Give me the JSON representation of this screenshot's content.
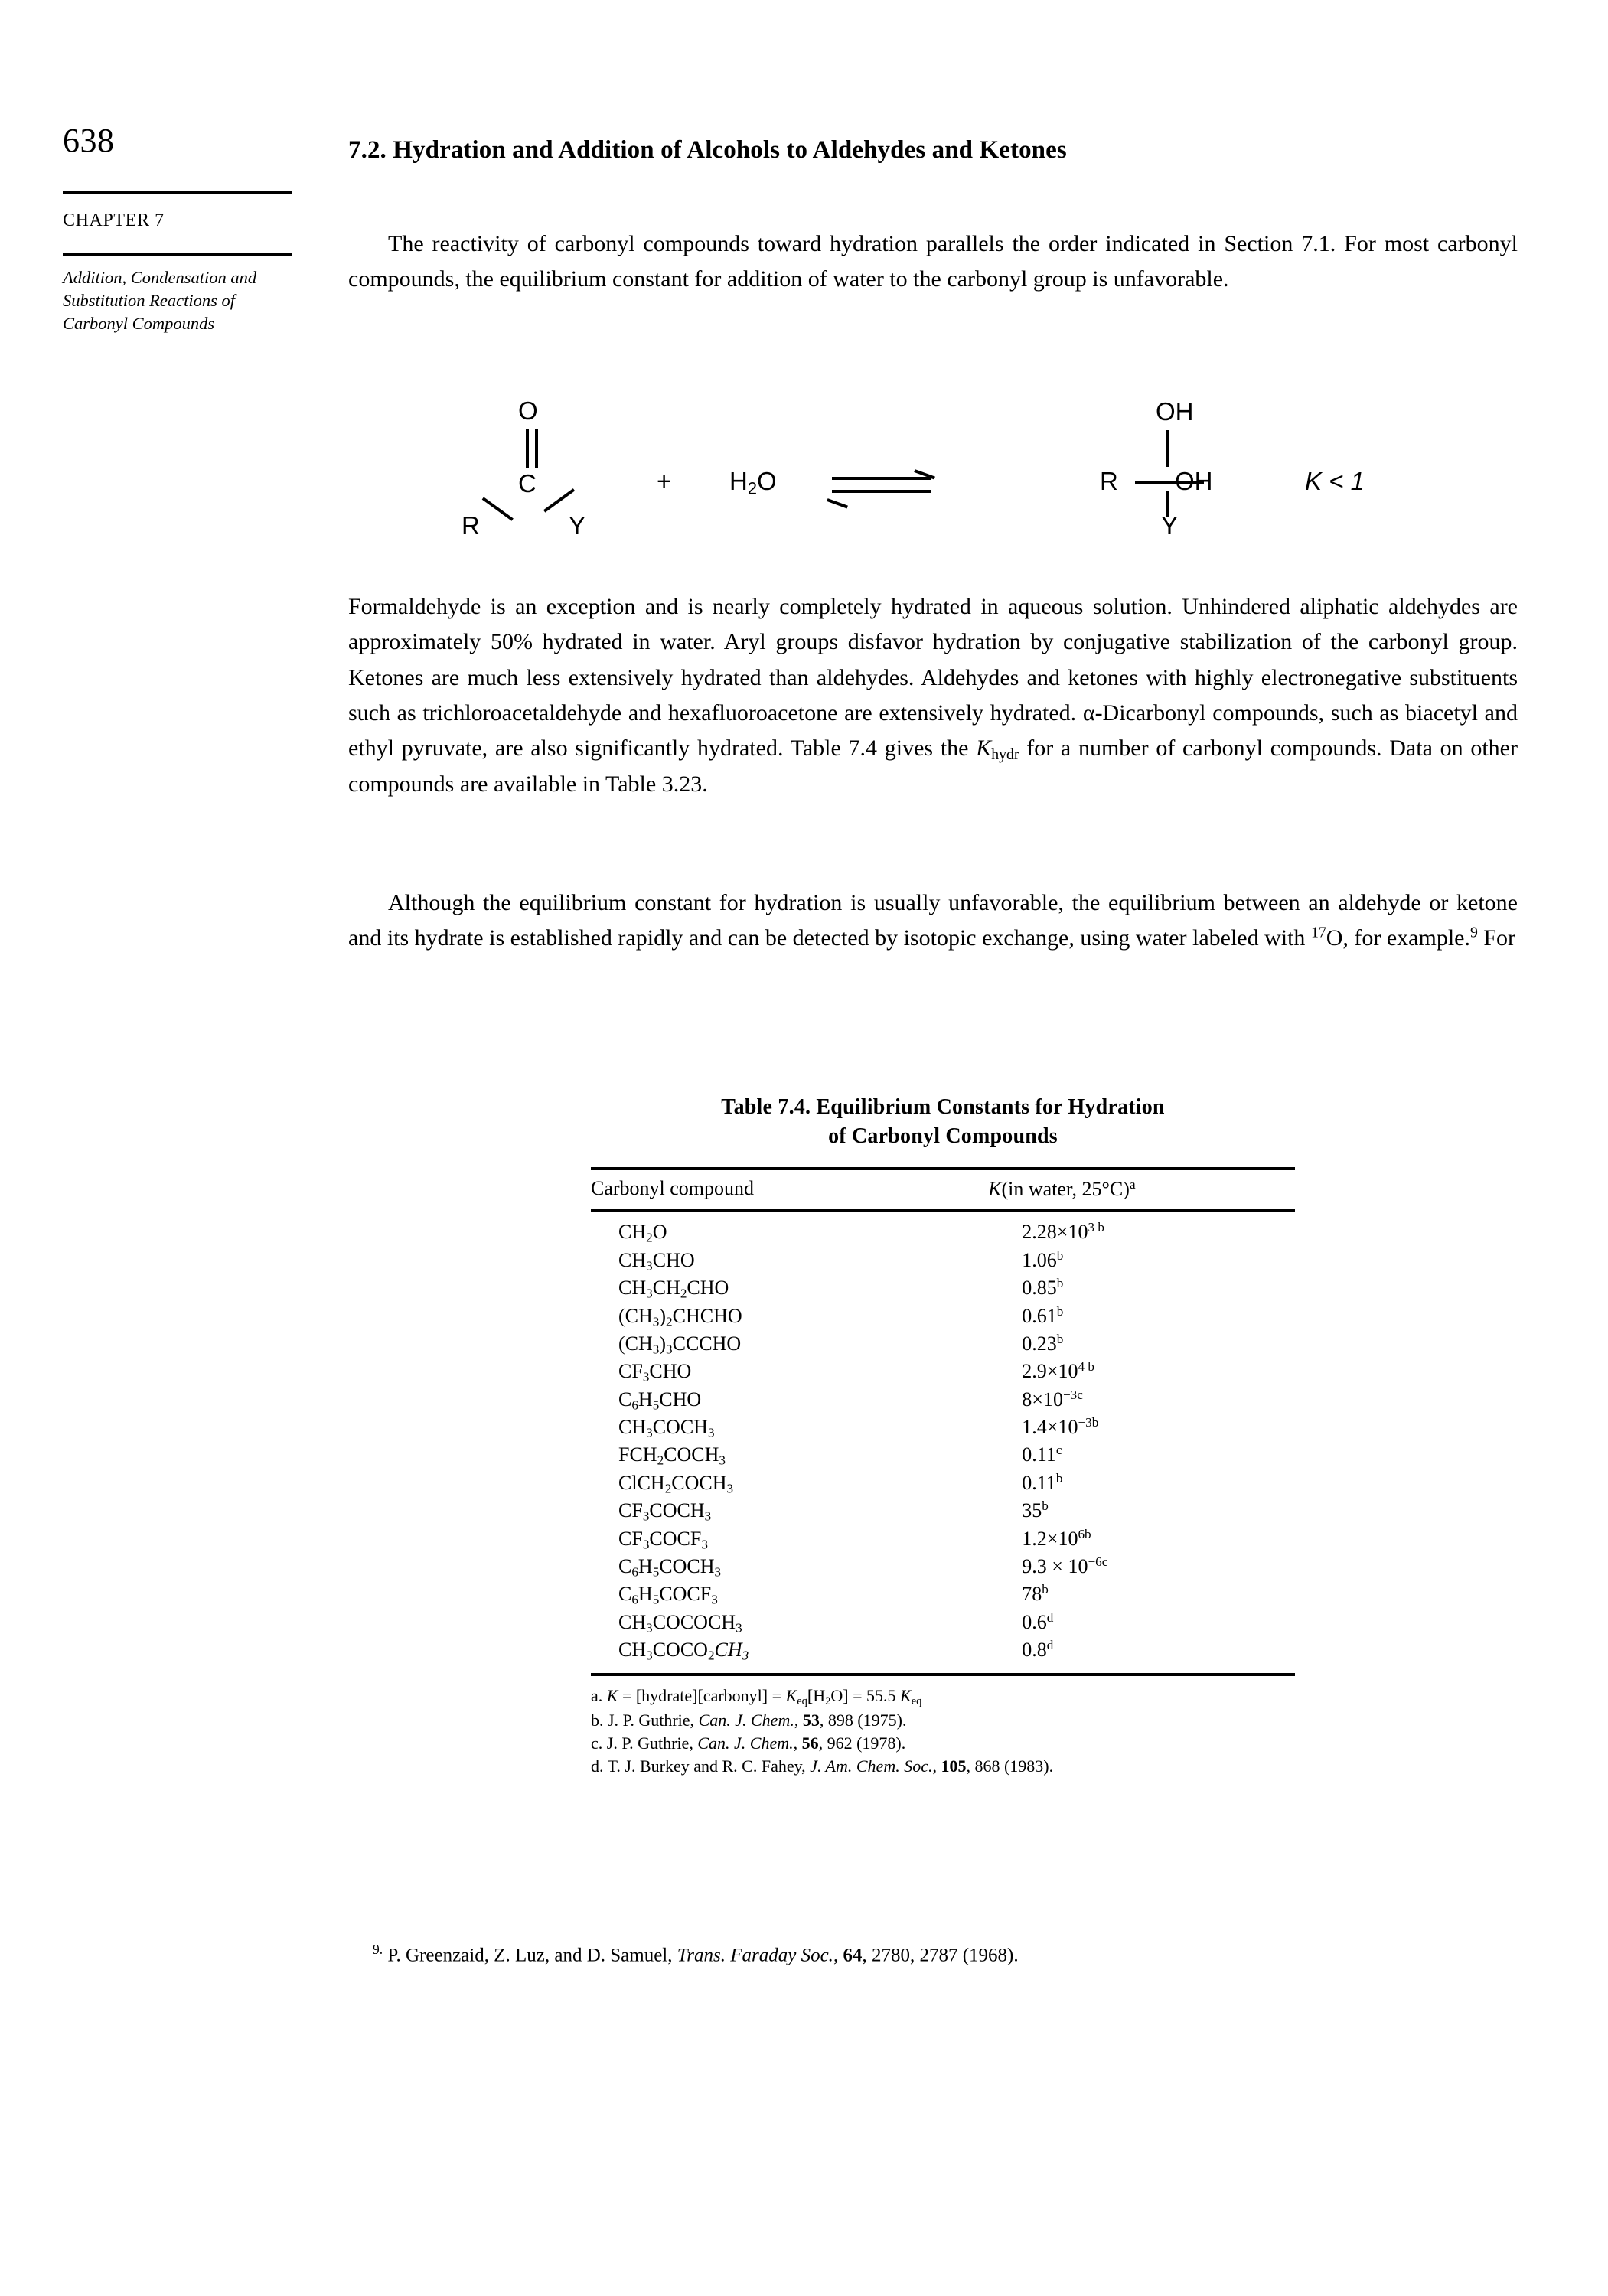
{
  "page": {
    "folio": "638",
    "chapter_label": "CHAPTER 7",
    "chapter_title": "Addition, Condensation and Substitution Reactions of Carbonyl Compounds"
  },
  "section": {
    "heading": "7.2. Hydration and Addition of Alcohols to Aldehydes and Ketones"
  },
  "paragraphs": {
    "p1": "The reactivity of carbonyl compounds toward hydration parallels the order indicated in Section 7.1. For most carbonyl compounds, the equilibrium constant for addition of water to the carbonyl group is unfavorable.",
    "p2_a": "Formaldehyde is an exception and is nearly completely hydrated in aqueous solution. Unhindered aliphatic aldehydes are approximately 50% hydrated in water. Aryl groups disfavor hydration by conjugative stabilization of the carbonyl group. Ketones are much less extensively hydrated than aldehydes. Aldehydes and ketones with highly electronegative substituents such as trichloroacetaldehyde and hexafluoroacetone are extensively hydrated. α-Dicarbonyl compounds, such as biacetyl and ethyl pyruvate, are also significantly hydrated. Table 7.4 gives the ",
    "p2_k": "K",
    "p2_khydr_sub": "hydr",
    "p2_b": " for a number of carbonyl compounds. Data on other compounds are available in Table 3.23.",
    "p3_a": "Although the equilibrium constant for hydration is usually unfavorable, the equilibrium between an aldehyde or ketone and its hydrate is established rapidly and can be detected by isotopic exchange, using water labeled with ",
    "p3_iso": "17",
    "p3_b": "O, for example.",
    "p3_ref": "9",
    "p3_c": " For"
  },
  "scheme": {
    "o_label": "O",
    "c_label": "C",
    "r_label": "R",
    "y_label": "Y",
    "plus": "+",
    "water": "H",
    "water_sub": "2",
    "water_o": "O",
    "oh_top": "OH",
    "r2_label": "R",
    "oh_right": "OH",
    "y2_label": "Y",
    "k_expr": "K < 1"
  },
  "table": {
    "caption_line1": "Table 7.4. Equilibrium Constants for Hydration",
    "caption_line2": "of Carbonyl Compounds",
    "headers": {
      "compound": "Carbonyl compound",
      "k_italic": "K",
      "k_rest": "(in water, 25°C)",
      "k_note": "a"
    },
    "rows": [
      {
        "formula_html": "CH<sub class=\"chem\">2</sub>O",
        "value_html": "2.28×10<sup class=\"chem\">3 b</sup>"
      },
      {
        "formula_html": "CH<sub class=\"chem\">3</sub>CHO",
        "value_html": "1.06<sup class=\"chem\">b</sup>"
      },
      {
        "formula_html": "CH<sub class=\"chem\">3</sub>CH<sub class=\"chem\">2</sub>CHO",
        "value_html": "0.85<sup class=\"chem\">b</sup>"
      },
      {
        "formula_html": "(CH<sub class=\"chem\">3</sub>)<sub class=\"chem\">2</sub>CHCHO",
        "value_html": "0.61<sup class=\"chem\">b</sup>"
      },
      {
        "formula_html": "(CH<sub class=\"chem\">3</sub>)<sub class=\"chem\">3</sub>CCCHO",
        "value_html": "0.23<sup class=\"chem\">b</sup>"
      },
      {
        "formula_html": "CF<sub class=\"chem\">3</sub>CHO",
        "value_html": "2.9×10<sup class=\"chem\">4 b</sup>"
      },
      {
        "formula_html": "C<sub class=\"chem\">6</sub>H<sub class=\"chem\">5</sub>CHO",
        "value_html": "8×10<sup class=\"chem\">−3c</sup>"
      },
      {
        "formula_html": "CH<sub class=\"chem\">3</sub>COCH<sub class=\"chem\">3</sub>",
        "value_html": "1.4×10<sup class=\"chem\">−3b</sup>"
      },
      {
        "formula_html": "FCH<sub class=\"chem\">2</sub>COCH<sub class=\"chem\">3</sub>",
        "value_html": "0.11<sup class=\"chem\">c</sup>"
      },
      {
        "formula_html": "ClCH<sub class=\"chem\">2</sub>COCH<sub class=\"chem\">3</sub>",
        "value_html": "0.11<sup class=\"chem\">b</sup>"
      },
      {
        "formula_html": "CF<sub class=\"chem\">3</sub>COCH<sub class=\"chem\">3</sub>",
        "value_html": "35<sup class=\"chem\">b</sup>"
      },
      {
        "formula_html": "CF<sub class=\"chem\">3</sub>COCF<sub class=\"chem\">3</sub>",
        "value_html": "1.2×10<sup class=\"chem\">6b</sup>"
      },
      {
        "formula_html": "C<sub class=\"chem\">6</sub>H<sub class=\"chem\">5</sub>COCH<sub class=\"chem\">3</sub>",
        "value_html": "9.3 × 10<sup class=\"chem\">−6c</sup>"
      },
      {
        "formula_html": "C<sub class=\"chem\">6</sub>H<sub class=\"chem\">5</sub>COCF<sub class=\"chem\">3</sub>",
        "value_html": "78<sup class=\"chem\">b</sup>"
      },
      {
        "formula_html": "CH<sub class=\"chem\">3</sub>COCOCH<sub class=\"chem\">3</sub>",
        "value_html": "0.6<sup class=\"chem\">d</sup>"
      },
      {
        "formula_html": "CH<sub class=\"chem\">3</sub>COCO<sub class=\"chem\">2</sub><span class=\"ital\">CH<sub class=\"chem\">3</sub></span>",
        "value_html": "0.8<sup class=\"chem\">d</sup>"
      }
    ],
    "footnotes": [
      "a. <span class=\"ital\">K</span> = [hydrate][carbonyl] = <span class=\"ital\">K</span><sub class=\"chem\">eq</sub>[H<sub class=\"chem\">2</sub>O] = 55.5 <span class=\"ital\">K</span><sub class=\"chem\">eq</sub>",
      "b. J. P. Guthrie, <span class=\"ital\">Can. J. Chem.</span>, <span class=\"bold\">53</span>, 898 (1975).",
      "c. J. P. Guthrie, <span class=\"ital\">Can. J. Chem.</span>, <span class=\"bold\">56</span>, 962 (1978).",
      "d. T. J. Burkey and R. C. Fahey, <span class=\"ital\">J. Am. Chem. Soc.</span>, <span class=\"bold\">105</span>, 868 (1983)."
    ]
  },
  "page_footnote": {
    "marker": "9.",
    "text_html": " P. Greenzaid, Z. Luz, and D. Samuel, <span class=\"ital\">Trans. Faraday Soc.</span>, <span class=\"bold\">64</span>, 2780, 2787 (1968)."
  }
}
